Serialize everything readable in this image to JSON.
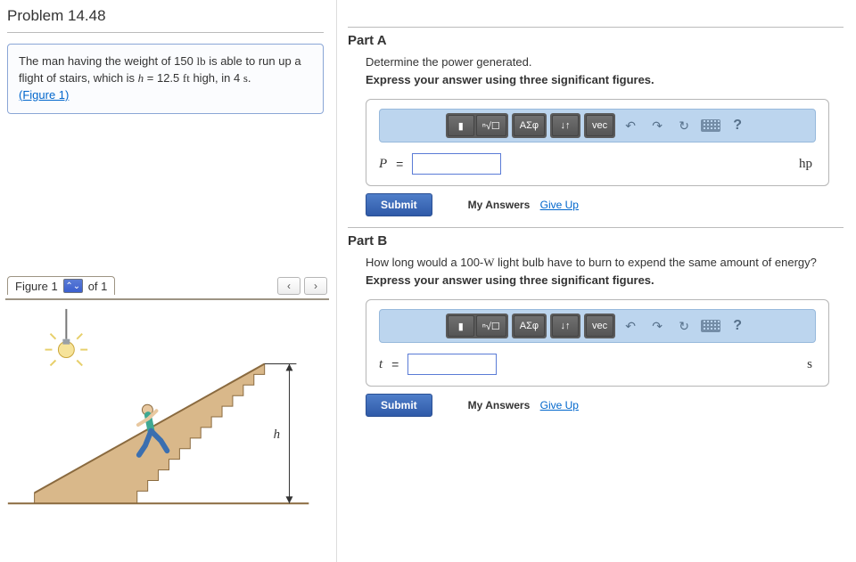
{
  "problem_title": "Problem 14.48",
  "intro": {
    "prefix": "The man having the weight of 150 ",
    "unit1": "lb",
    "mid1": " is able to run up a flight of stairs, which is ",
    "var_h": "h",
    "eq": " = 12.5 ",
    "unit2": "ft",
    "mid2": " high, in 4 ",
    "unit3": "s",
    "period": ".",
    "figure_link": "(Figure 1)"
  },
  "figure": {
    "tab_label": "Figure 1",
    "of": "of 1",
    "prev": "‹",
    "next": "›",
    "select_glyph": "⌃⌄",
    "label_h": "h"
  },
  "parts": {
    "A": {
      "heading": "Part A",
      "prompt": "Determine the power generated.",
      "sigfig": "Express your answer using three significant figures.",
      "var": "P",
      "eq": " = ",
      "unit": "hp"
    },
    "B": {
      "heading": "Part B",
      "prompt_prefix": "How long would a 100-",
      "prompt_unit": "W",
      "prompt_suffix": " light bulb have to burn to expend the same amount of energy?",
      "sigfig": "Express your answer using three significant figures.",
      "var": "t",
      "eq": " = ",
      "unit": "s"
    }
  },
  "toolbar": {
    "template": "▮",
    "sqrt": "ⁿ√☐",
    "greek": "ΑΣφ",
    "subsup": "↓↑",
    "vec": "vec",
    "undo": "↶",
    "redo": "↷",
    "reset": "↻",
    "help": "?"
  },
  "submit": {
    "button": "Submit",
    "label": "My Answers",
    "giveup": "Give Up"
  }
}
